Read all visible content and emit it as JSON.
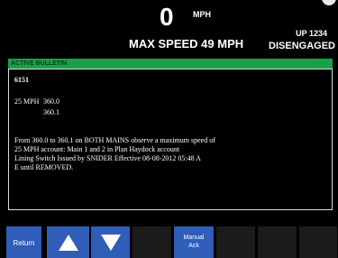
{
  "speed": {
    "value": "0",
    "unit": "MPH"
  },
  "max_speed": "MAX SPEED 49 MPH",
  "train_id": "UP 1234",
  "mode_status": "DISENGAGED",
  "bulletin_header": "ACTIVE BULLETIN",
  "bulletin": {
    "id": "6151",
    "speed_limit": "25 MPH",
    "range_start": "360.0",
    "range_end": "360.1",
    "body_lines": [
      "From 360.0 to 360.1 on BOTH MAINS observe a maximum speed of",
      "25 MPH account: Main 1 and 2 in Plan Haydock account",
      "Lining Switch Issued by SNIDER Effective 08-08-2012 05:48 A",
      "E until REMOVED."
    ]
  },
  "buttons": {
    "return_label": "Return",
    "manual_ack_line1": "Manual",
    "manual_ack_line2": "Ack",
    "up_icon": "up-arrow-icon",
    "down_icon": "down-arrow-icon"
  },
  "colors": {
    "background": "#000000",
    "bulletin_bar": "#19a04a",
    "button_blue": "#2f5db8",
    "button_dark": "#1b1b1b"
  }
}
